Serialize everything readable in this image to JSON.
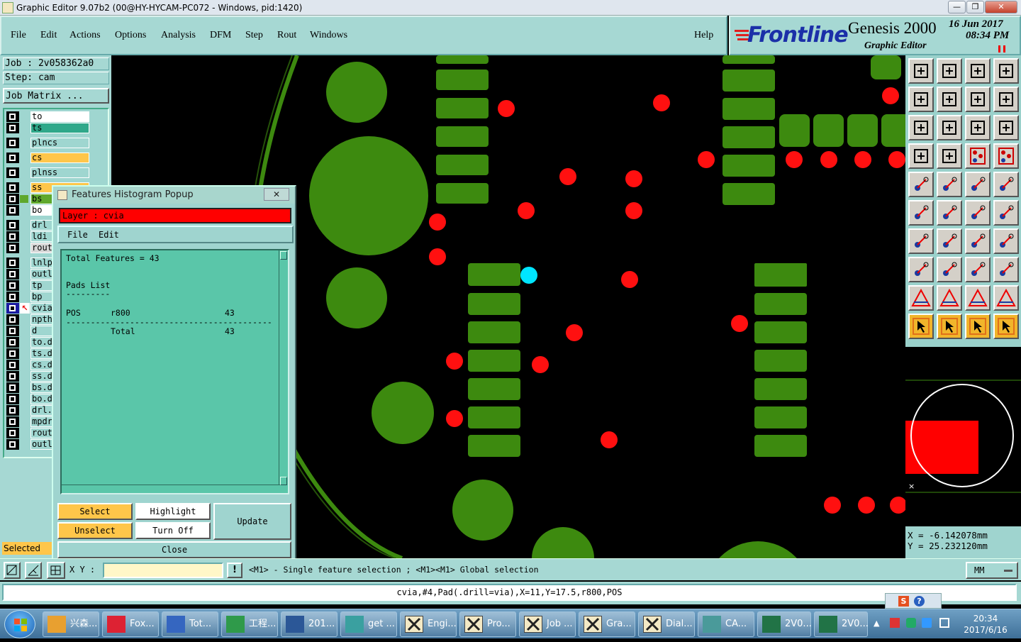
{
  "window": {
    "title": "Graphic Editor 9.07b2 (00@HY-HYCAM-PC072 - Windows, pid:1420)",
    "minimize_glyph": "—",
    "restore_glyph": "❐",
    "close_glyph": "✕"
  },
  "menu": [
    "File",
    "Edit",
    "Actions",
    "Options",
    "Analysis",
    "DFM",
    "Step",
    "Rout",
    "Windows"
  ],
  "help_label": "Help",
  "brand": {
    "logo_text": "Frontline",
    "product": "Genesis 2000",
    "subtitle": "Graphic Editor",
    "date": "16 Jun 2017",
    "time": "08:34 PM"
  },
  "job_info": {
    "job": "Job : 2v058362a0",
    "step": "Step: cam",
    "matrix_button": "Job Matrix ..."
  },
  "layers": [
    {
      "name": "to",
      "color": "#ffffff"
    },
    {
      "name": "ts",
      "color": "#2fa88a"
    },
    {
      "name": "plncs",
      "color": "#9fd6d0"
    },
    {
      "name": "cs",
      "color": "#ffc64a"
    },
    {
      "name": "plnss",
      "color": "#9fd6d0"
    },
    {
      "name": "ss",
      "color": "#ffc64a"
    },
    {
      "name": "bs",
      "color": "#5fa82d"
    },
    {
      "name": "bo",
      "color": "#ffffff"
    },
    {
      "name": "drl",
      "color": "#9fd6d0"
    },
    {
      "name": "ldi",
      "color": "#9fd6d0"
    },
    {
      "name": "rout",
      "color": "#d8d8d8"
    },
    {
      "name": "lnlp",
      "color": "#9fd6d0"
    },
    {
      "name": "outl",
      "color": "#9fd6d0"
    },
    {
      "name": "tp",
      "color": "#9fd6d0"
    },
    {
      "name": "bp",
      "color": "#9fd6d0"
    },
    {
      "name": "cvia",
      "color": "#9fd6d0"
    },
    {
      "name": "npth",
      "color": "#9fd6d0"
    },
    {
      "name": "d",
      "color": "#9fd6d0"
    },
    {
      "name": "to.d",
      "color": "#9fd6d0"
    },
    {
      "name": "ts.d",
      "color": "#9fd6d0"
    },
    {
      "name": "cs.d",
      "color": "#9fd6d0"
    },
    {
      "name": "ss.d",
      "color": "#9fd6d0"
    },
    {
      "name": "bs.d",
      "color": "#9fd6d0"
    },
    {
      "name": "bo.d",
      "color": "#9fd6d0"
    },
    {
      "name": "drl.",
      "color": "#9fd6d0"
    },
    {
      "name": "mpdr",
      "color": "#9fd6d0"
    },
    {
      "name": "rout",
      "color": "#9fd6d0"
    },
    {
      "name": "outl",
      "color": "#9fd6d0"
    }
  ],
  "selected_label": "Selected",
  "popup": {
    "title": "Features Histogram Popup",
    "close_glyph": "✕",
    "layer_text": "Layer :  cvia",
    "menu": [
      "File",
      "Edit"
    ],
    "total_line": "Total Features = 43",
    "pads_title": "Pads List",
    "pads_underline": "---------",
    "rows": [
      {
        "pol": "POS",
        "sym": "r800",
        "count": "43"
      }
    ],
    "divider": "------------------------------------------",
    "total_label": "Total",
    "total_count": "43",
    "buttons": {
      "select": "Select",
      "highlight": "Highlight",
      "update": "Update",
      "unselect": "Unselect",
      "turn_off": "Turn Off",
      "close": "Close"
    }
  },
  "coords": {
    "x": "X = -6.142078mm",
    "y": "Y = 25.232120mm"
  },
  "status": {
    "xy_label": "X Y :",
    "hint": "<M1> - Single feature selection ; <M1><M1> Global selection",
    "units": "MM",
    "info_line": "cvia,#4,Pad(.drill=via),X=11,Y=17.5,r800,POS"
  },
  "tray": {
    "time": "20:34",
    "date": "2017/6/16"
  },
  "taskbar": [
    {
      "label": "兴森...",
      "icon": "shell-icon"
    },
    {
      "label": "Fox...",
      "icon": "foxit-icon"
    },
    {
      "label": "Tot...",
      "icon": "disk-icon"
    },
    {
      "label": "工程...",
      "icon": "project-icon"
    },
    {
      "label": "201...",
      "icon": "word-icon"
    },
    {
      "label": "get ...",
      "icon": "eye-icon"
    },
    {
      "label": "Engi...",
      "icon": "genesis-icon"
    },
    {
      "label": "Pro...",
      "icon": "genesis-icon"
    },
    {
      "label": "Job ...",
      "icon": "genesis-icon"
    },
    {
      "label": "Gra...",
      "icon": "genesis-icon"
    },
    {
      "label": "Dial...",
      "icon": "genesis-icon"
    },
    {
      "label": "CA...",
      "icon": "cam-icon"
    },
    {
      "label": "2V0...",
      "icon": "excel-icon"
    },
    {
      "label": "2V0...",
      "icon": "excel-icon"
    }
  ],
  "colors": {
    "panel": "#a6d8d3",
    "copper": "#3d8a0f",
    "via": "#ff0000",
    "selected": "#00e5ff",
    "accent_orange": "#ffc64a"
  }
}
